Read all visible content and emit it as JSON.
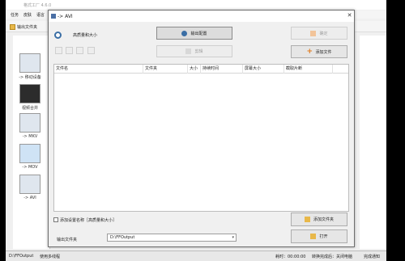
{
  "app": {
    "title": "格式工厂 4.6.0",
    "menu": [
      "任务",
      "皮肤",
      "语言",
      "帮助"
    ],
    "toolbar_output_folder": "输出文件夹",
    "sidebar": [
      {
        "label": "-> 移动设备"
      },
      {
        "label": "视频合并"
      },
      {
        "label": "-> MKV"
      },
      {
        "label": "-> MOV"
      },
      {
        "label": "-> AVI"
      }
    ],
    "status": {
      "path": "D:\\FFOutput",
      "multi_thread": "使用多线程",
      "elapsed_label": "耗时：00:00:00",
      "after_convert": "转换完成后：关闭电脑",
      "notify": "完成通知"
    }
  },
  "dialog": {
    "title": "-> AVI",
    "close_glyph": "✕",
    "quality_label": "高质量和大小",
    "output_config_button": "输出配置",
    "ok_button": "确定",
    "clip_button": "剪辑",
    "add_file_button": "添加文件",
    "table_columns": [
      "文件名",
      "文件夹",
      "大小",
      "持续时间",
      "屏幕大小",
      "截取片断"
    ],
    "add_setting_name_checkbox": "添加设置名称［高质量和大小］",
    "add_folder_button": "添加文件夹",
    "output_folder_label": "输出文件夹",
    "output_folder_value": "D:\\FFOutput",
    "open_button": "打开"
  }
}
